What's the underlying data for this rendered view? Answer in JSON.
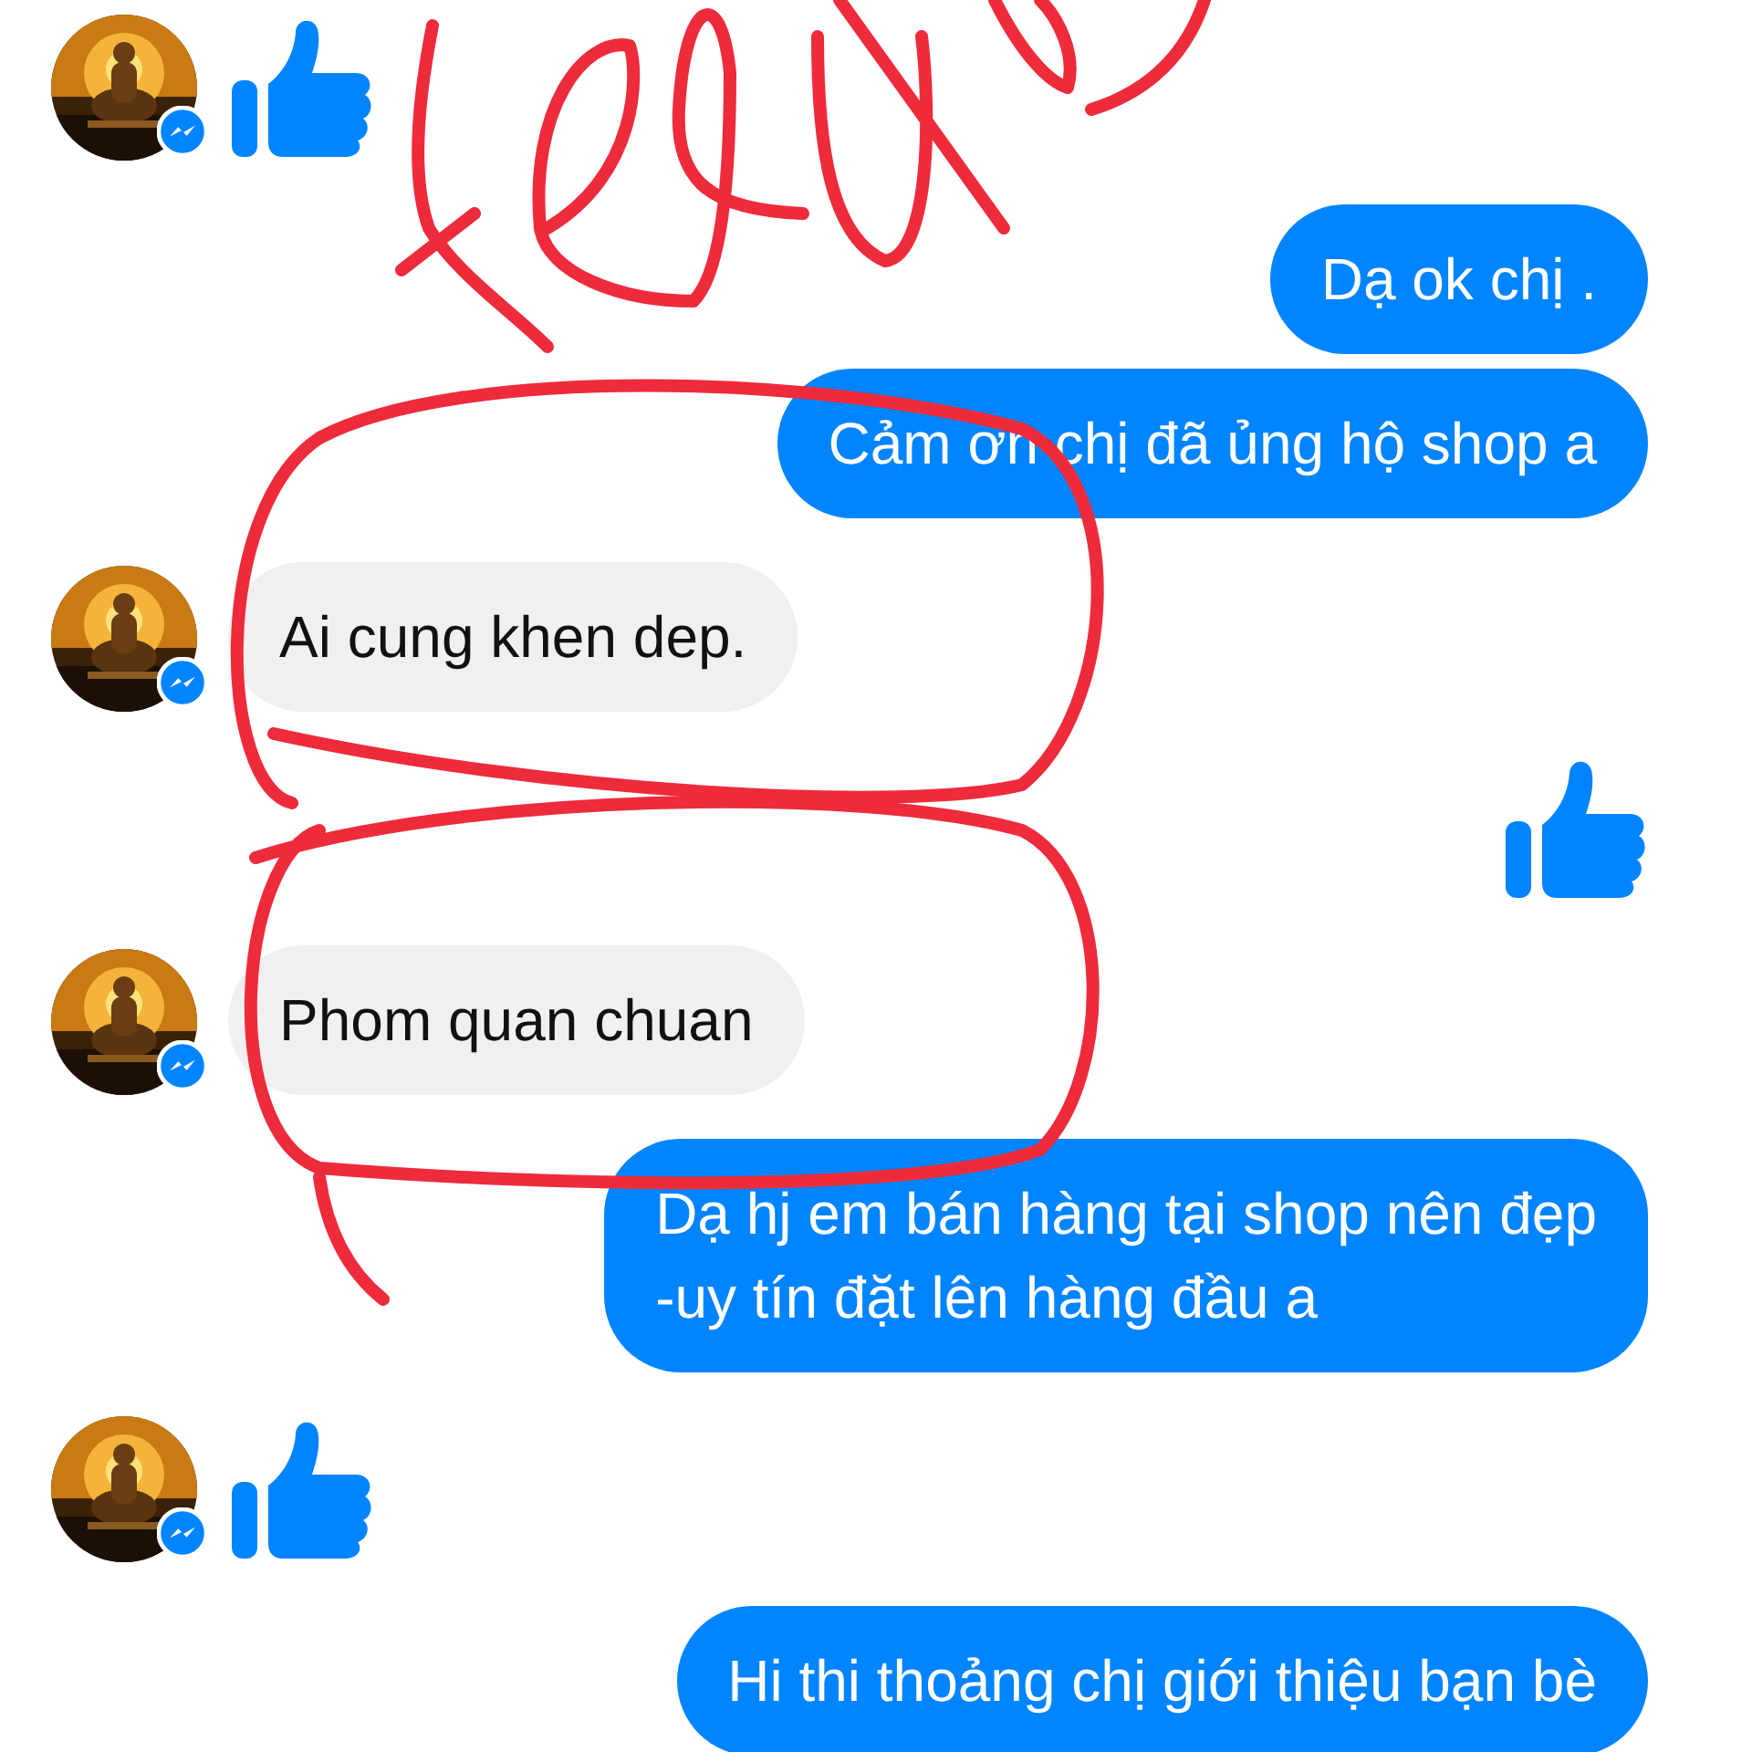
{
  "messages": [
    {
      "kind": "incoming_like"
    },
    {
      "kind": "outgoing_text",
      "lines": [
        "Dạ ok chị ."
      ]
    },
    {
      "kind": "outgoing_text",
      "lines": [
        "Cảm ơn chị đã ủng hộ shop a"
      ]
    },
    {
      "kind": "incoming_text",
      "lines": [
        "Ai cung khen dep."
      ]
    },
    {
      "kind": "outgoing_like"
    },
    {
      "kind": "incoming_text",
      "lines": [
        "Phom quan chuan"
      ]
    },
    {
      "kind": "outgoing_text",
      "lines": [
        "Dạ hj em bán hàng tại shop nên đẹp",
        "-uy tín đặt lên hàng đầu a"
      ]
    },
    {
      "kind": "incoming_like"
    },
    {
      "kind": "outgoing_text",
      "lines": [
        "Hi thi thoảng chị giới thiệu bạn bè"
      ]
    }
  ]
}
